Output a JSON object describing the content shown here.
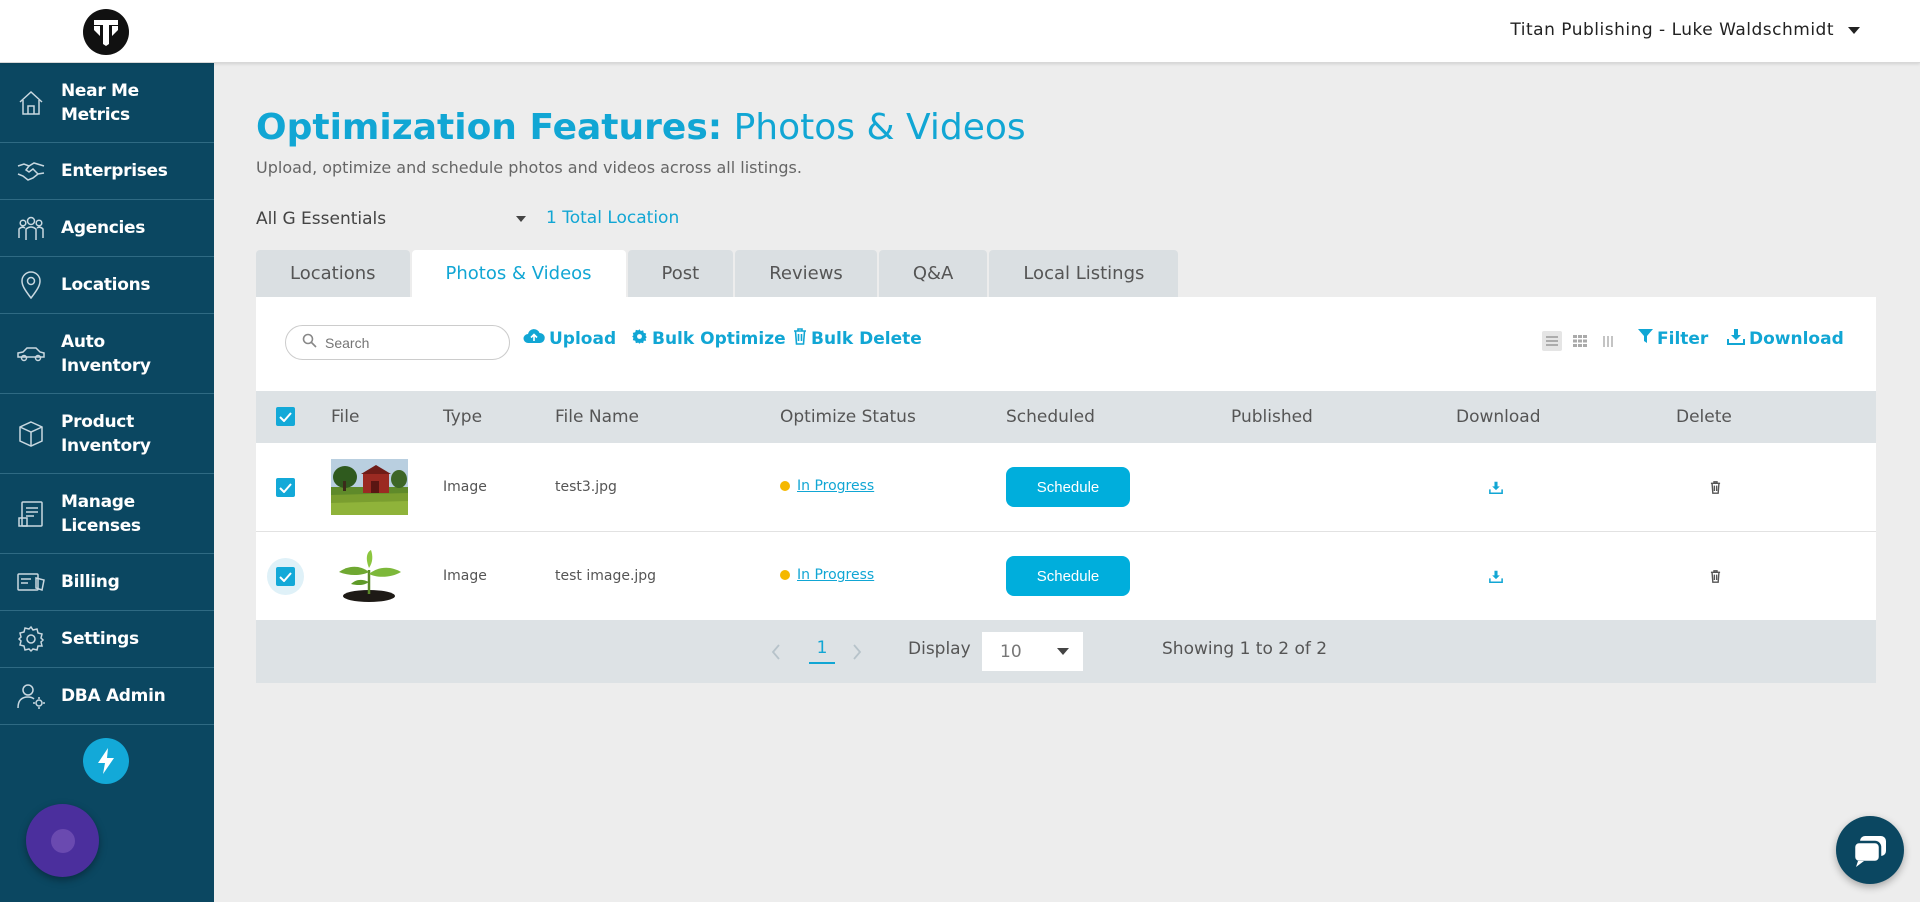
{
  "header": {
    "account_label": "Titan Publishing - Luke Waldschmidt"
  },
  "sidebar": {
    "items": [
      {
        "label": "Near Me\nMetrics",
        "icon": "home-icon"
      },
      {
        "label": "Enterprises",
        "icon": "handshake-icon"
      },
      {
        "label": "Agencies",
        "icon": "people-group-icon"
      },
      {
        "label": "Locations",
        "icon": "map-pin-icon"
      },
      {
        "label": "Auto\nInventory",
        "icon": "car-icon"
      },
      {
        "label": "Product\nInventory",
        "icon": "box-icon"
      },
      {
        "label": "Manage\nLicenses",
        "icon": "license-document-icon"
      },
      {
        "label": "Billing",
        "icon": "billing-icon"
      },
      {
        "label": "Settings",
        "icon": "gear-icon"
      },
      {
        "label": "DBA Admin",
        "icon": "admin-user-gear-icon"
      }
    ]
  },
  "page": {
    "title_bold": "Optimization Features:",
    "title_light": "Photos & Videos",
    "subtitle": "Upload, optimize and schedule photos and videos across all listings.",
    "group_selected": "All G Essentials",
    "total_locations": "1 Total Location"
  },
  "tabs": [
    {
      "label": "Locations",
      "active": false
    },
    {
      "label": "Photos & Videos",
      "active": true
    },
    {
      "label": "Post",
      "active": false
    },
    {
      "label": "Reviews",
      "active": false
    },
    {
      "label": "Q&A",
      "active": false
    },
    {
      "label": "Local Listings",
      "active": false
    }
  ],
  "toolbar": {
    "search_placeholder": "Search",
    "upload_label": "Upload",
    "bulk_optimize_label": "Bulk Optimize",
    "bulk_delete_label": "Bulk Delete",
    "filter_label": "Filter",
    "download_label": "Download"
  },
  "table": {
    "columns": [
      "File",
      "Type",
      "File Name",
      "Optimize Status",
      "Scheduled",
      "Published",
      "Download",
      "Delete"
    ],
    "rows": [
      {
        "type": "Image",
        "file_name": "test3.jpg",
        "status": "In Progress",
        "schedule_label": "Schedule",
        "checked": true,
        "thumbnail": "barn-field-photo"
      },
      {
        "type": "Image",
        "file_name": "test image.jpg",
        "status": "In Progress",
        "schedule_label": "Schedule",
        "checked": true,
        "thumbnail": "sprout-plant-photo"
      }
    ]
  },
  "pagination": {
    "current_page": "1",
    "display_label": "Display",
    "page_size": "10",
    "summary": "Showing 1 to 2 of 2"
  },
  "colors": {
    "accent": "#11a6d4",
    "sidebar_bg": "#0b4761",
    "status_dot": "#f5b800",
    "schedule_button": "#00aedc"
  }
}
